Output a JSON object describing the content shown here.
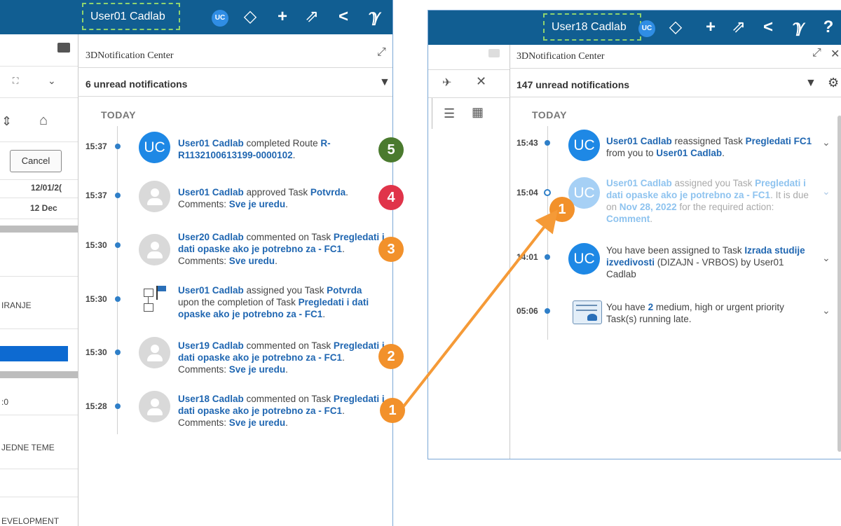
{
  "left_panel": {
    "user_label": "User01 Cadlab",
    "avatar_initials": "UC",
    "nc_title": "3DNotification Center",
    "unread": "6 unread notifications",
    "today": "TODAY",
    "cancel_label": "Cancel",
    "date1": "12/01/2(",
    "date2": "12 Dec",
    "side_text1": "IRANJE",
    "side_text2": ":0",
    "side_text3": "JEDNE TEME",
    "side_text4": "EVELOPMENT",
    "notifications": [
      {
        "time": "15:37",
        "avatar": "UC",
        "a1": "User01 Cadlab",
        "t1": " completed Route ",
        "a2": "R-R1132100613199-0000102",
        "t2": "."
      },
      {
        "time": "15:37",
        "a1": "User01 Cadlab",
        "t1": " approved Task ",
        "a2": "Potvrda",
        "t2": ".",
        "t3": "Comments: ",
        "a3": "Sve je uredu",
        "t4": "."
      },
      {
        "time": "15:30",
        "a1": "User20 Cadlab",
        "t1": " commented on Task ",
        "a2": "Pregledati i dati opaske ako je potrebno za - FC1",
        "t2": ". Comments: ",
        "a3": "Sve uredu",
        "t3": "."
      },
      {
        "time": "15:30",
        "a1": "User01 Cadlab",
        "t1": " assigned you Task ",
        "a2": "Potvrda",
        "t2": " upon the completion of Task ",
        "a3": "Pregledati i dati opaske ako je potrebno za - FC1",
        "t3": "."
      },
      {
        "time": "15:30",
        "a1": "User19 Cadlab",
        "t1": " commented on Task ",
        "a2": "Pregledati i dati opaske ako je potrebno za - FC1",
        "t2": ". Comments: ",
        "a3": "Sve je uredu",
        "t3": "."
      },
      {
        "time": "15:28",
        "a1": "User18 Cadlab",
        "t1": " commented on Task ",
        "a2": "Pregledati i dati opaske ako je potrebno za - FC1",
        "t2": ". Comments: ",
        "a3": "Sve je uredu",
        "t3": "."
      }
    ]
  },
  "right_panel": {
    "user_label": "User18 Cadlab",
    "avatar_initials": "UC",
    "nc_title": "3DNotification Center",
    "unread": "147 unread notifications",
    "today": "TODAY",
    "notifications": [
      {
        "time": "15:43",
        "avatar": "UC",
        "a1": "User01 Cadlab",
        "t1": " reassigned Task ",
        "a2": "Pregledati FC1",
        "t2": " from you to ",
        "a3": "User01 Cadlab",
        "t3": "."
      },
      {
        "time": "15:04",
        "avatar": "UC",
        "a1": "User01 Cadlab",
        "t1": " assigned you Task ",
        "a2": "Pregledati i dati opaske ako je potrebno za - FC1",
        "t2": ". It is due on ",
        "a3": "Nov 28, 2022",
        "t3": " for the required action: ",
        "a4": "Comment",
        "t4": "."
      },
      {
        "time": "14:01",
        "avatar": "UC",
        "t0": "You have been assigned to Task ",
        "a1": "Izrada studije izvedivosti",
        "t1": " (DIZAJN - VRBOS) by User01 Cadlab"
      },
      {
        "time": "05:06",
        "t0": "You have ",
        "a1": "2",
        "t1": " medium, high or urgent priority Task(s) running late."
      }
    ]
  },
  "badges": [
    {
      "n": "5",
      "color": "#4a7a2e"
    },
    {
      "n": "4",
      "color": "#e0344a"
    },
    {
      "n": "3",
      "color": "#f2912b"
    },
    {
      "n": "2",
      "color": "#f2912b"
    },
    {
      "n": "1",
      "color": "#f2912b"
    },
    {
      "n": "1",
      "color": "#f2912b"
    }
  ],
  "colors": {
    "topbar": "#115e92",
    "link": "#1f66b1",
    "arrow": "#f59a37",
    "dashed_box": "#8fd36e"
  },
  "icons": [
    "comment-icon",
    "uc-avatar-icon",
    "compass-icon",
    "plus-icon",
    "share-icon",
    "network-icon",
    "tools-icon",
    "help-icon",
    "pin-icon",
    "close-icon",
    "expand-icon",
    "filter-icon",
    "gear-icon",
    "home-icon",
    "chevron-down-icon"
  ]
}
